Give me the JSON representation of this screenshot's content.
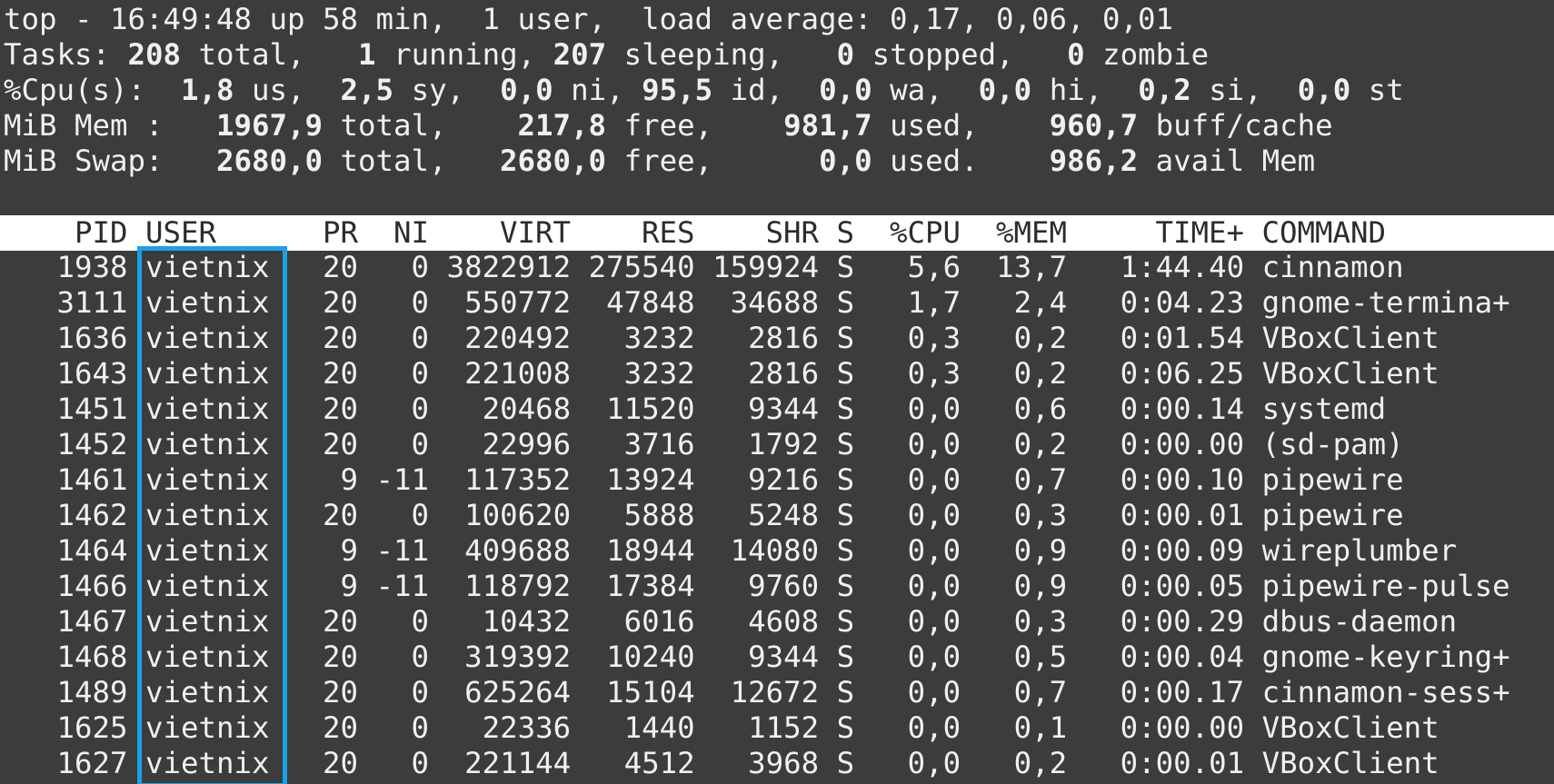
{
  "summary": {
    "uptime_line": [
      "top - 16:49:48 up 58 min,  1 user,  load average: 0,17, 0,06, 0,01"
    ],
    "tasks_line": [
      "Tasks: ",
      "208",
      " total,   ",
      "1",
      " running, ",
      "207",
      " sleeping,   ",
      "0",
      " stopped,   ",
      "0",
      " zombie"
    ],
    "cpu_line": [
      "%Cpu(s):  ",
      "1,8",
      " us,  ",
      "2,5",
      " sy,  ",
      "0,0",
      " ni, ",
      "95,5",
      " id,  ",
      "0,0",
      " wa,  ",
      "0,0",
      " hi,  ",
      "0,2",
      " si,  ",
      "0,0",
      " st"
    ],
    "mem_line": [
      "MiB Mem :   ",
      "1967,9",
      " total,    ",
      "217,8",
      " free,    ",
      "981,7",
      " used,    ",
      "960,7",
      " buff/cache"
    ],
    "swap_line": [
      "MiB Swap:   ",
      "2680,0",
      " total,   ",
      "2680,0",
      " free,      ",
      "0,0",
      " used.    ",
      "986,2",
      " avail Mem"
    ]
  },
  "table": {
    "header": "    PID USER      PR  NI    VIRT    RES    SHR S  %CPU  %MEM     TIME+ COMMAND",
    "columns": [
      "PID",
      "USER",
      "PR",
      "NI",
      "VIRT",
      "RES",
      "SHR",
      "S",
      "%CPU",
      "%MEM",
      "TIME+",
      "COMMAND"
    ],
    "rows": [
      [
        "1938",
        "vietnix",
        "20",
        "0",
        "3822912",
        "275540",
        "159924",
        "S",
        "5,6",
        "13,7",
        "1:44.40",
        "cinnamon"
      ],
      [
        "3111",
        "vietnix",
        "20",
        "0",
        "550772",
        "47848",
        "34688",
        "S",
        "1,7",
        "2,4",
        "0:04.23",
        "gnome-termina+"
      ],
      [
        "1636",
        "vietnix",
        "20",
        "0",
        "220492",
        "3232",
        "2816",
        "S",
        "0,3",
        "0,2",
        "0:01.54",
        "VBoxClient"
      ],
      [
        "1643",
        "vietnix",
        "20",
        "0",
        "221008",
        "3232",
        "2816",
        "S",
        "0,3",
        "0,2",
        "0:06.25",
        "VBoxClient"
      ],
      [
        "1451",
        "vietnix",
        "20",
        "0",
        "20468",
        "11520",
        "9344",
        "S",
        "0,0",
        "0,6",
        "0:00.14",
        "systemd"
      ],
      [
        "1452",
        "vietnix",
        "20",
        "0",
        "22996",
        "3716",
        "1792",
        "S",
        "0,0",
        "0,2",
        "0:00.00",
        "(sd-pam)"
      ],
      [
        "1461",
        "vietnix",
        "9",
        "-11",
        "117352",
        "13924",
        "9216",
        "S",
        "0,0",
        "0,7",
        "0:00.10",
        "pipewire"
      ],
      [
        "1462",
        "vietnix",
        "20",
        "0",
        "100620",
        "5888",
        "5248",
        "S",
        "0,0",
        "0,3",
        "0:00.01",
        "pipewire"
      ],
      [
        "1464",
        "vietnix",
        "9",
        "-11",
        "409688",
        "18944",
        "14080",
        "S",
        "0,0",
        "0,9",
        "0:00.09",
        "wireplumber"
      ],
      [
        "1466",
        "vietnix",
        "9",
        "-11",
        "118792",
        "17384",
        "9760",
        "S",
        "0,0",
        "0,9",
        "0:00.05",
        "pipewire-pulse"
      ],
      [
        "1467",
        "vietnix",
        "20",
        "0",
        "10432",
        "6016",
        "4608",
        "S",
        "0,0",
        "0,3",
        "0:00.29",
        "dbus-daemon"
      ],
      [
        "1468",
        "vietnix",
        "20",
        "0",
        "319392",
        "10240",
        "9344",
        "S",
        "0,0",
        "0,5",
        "0:00.04",
        "gnome-keyring+"
      ],
      [
        "1489",
        "vietnix",
        "20",
        "0",
        "625264",
        "15104",
        "12672",
        "S",
        "0,0",
        "0,7",
        "0:00.17",
        "cinnamon-sess+"
      ],
      [
        "1625",
        "vietnix",
        "20",
        "0",
        "22336",
        "1440",
        "1152",
        "S",
        "0,0",
        "0,1",
        "0:00.00",
        "VBoxClient"
      ],
      [
        "1627",
        "vietnix",
        "20",
        "0",
        "221144",
        "4512",
        "3968",
        "S",
        "0,0",
        "0,2",
        "0:00.01",
        "VBoxClient"
      ]
    ]
  },
  "colors": {
    "background": "#3c3c3c",
    "text": "#f0f0f0",
    "header_bg": "#ffffff",
    "header_text": "#2c2c2c",
    "highlight": "#1aa1e6"
  }
}
